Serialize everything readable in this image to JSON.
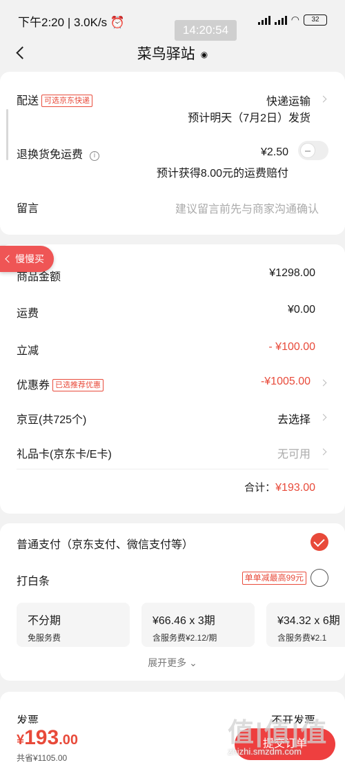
{
  "status_bar": {
    "time": "下午2:20",
    "speed": "3.0K/s",
    "network": "HD",
    "battery": "32"
  },
  "overlay_time": "14:20:54",
  "nav": {
    "title": "菜鸟驿站"
  },
  "delivery": {
    "label": "配送",
    "tag": "可选京东快递",
    "method": "快递运输",
    "eta": "预计明天（7月2日）发货"
  },
  "return_insurance": {
    "label": "退换货免运费",
    "price": "¥2.50",
    "note": "预计获得8.00元的运费赔付"
  },
  "message": {
    "label": "留言",
    "placeholder": "建议留言前先与商家沟通确认"
  },
  "slow_buy": "慢慢买",
  "summary": {
    "goods_label": "商品金额",
    "goods_value": "¥1298.00",
    "freight_label": "运费",
    "freight_value": "¥0.00",
    "discount_label": "立减",
    "discount_value": "- ¥100.00",
    "coupon_label": "优惠券",
    "coupon_tag": "已选推荐优惠",
    "coupon_value": "-¥1005.00",
    "jingdou_label": "京豆(共725个)",
    "jingdou_value": "去选择",
    "giftcard_label": "礼品卡(京东卡/E卡)",
    "giftcard_value": "无可用",
    "total_label": "合计：",
    "total_value": "¥193.00"
  },
  "payment": {
    "normal_label": "普通支付（京东支付、微信支付等）",
    "baitiao_label": "打白条",
    "baitiao_promo": "单单减最高99元",
    "plans": [
      {
        "main": "不分期",
        "sub": "免服务费"
      },
      {
        "main": "¥66.46 x 3期",
        "sub": "含服务费¥2.12/期"
      },
      {
        "main": "¥34.32 x 6期",
        "sub": "含服务费¥2.1"
      }
    ],
    "more": "展开更多"
  },
  "invoice": {
    "label": "发票",
    "value": "不开发票"
  },
  "bottom": {
    "currency": "¥",
    "amount_int": "193",
    "amount_dec": ".00",
    "saved": "共省¥1105.00",
    "submit": "提交订单"
  },
  "watermark": {
    "big": "值|值|值",
    "small": "zhizhi.smzdm.com"
  },
  "colors": {
    "accent": "#e84a3a",
    "background": "#f2f2f2",
    "card": "#ffffff"
  }
}
